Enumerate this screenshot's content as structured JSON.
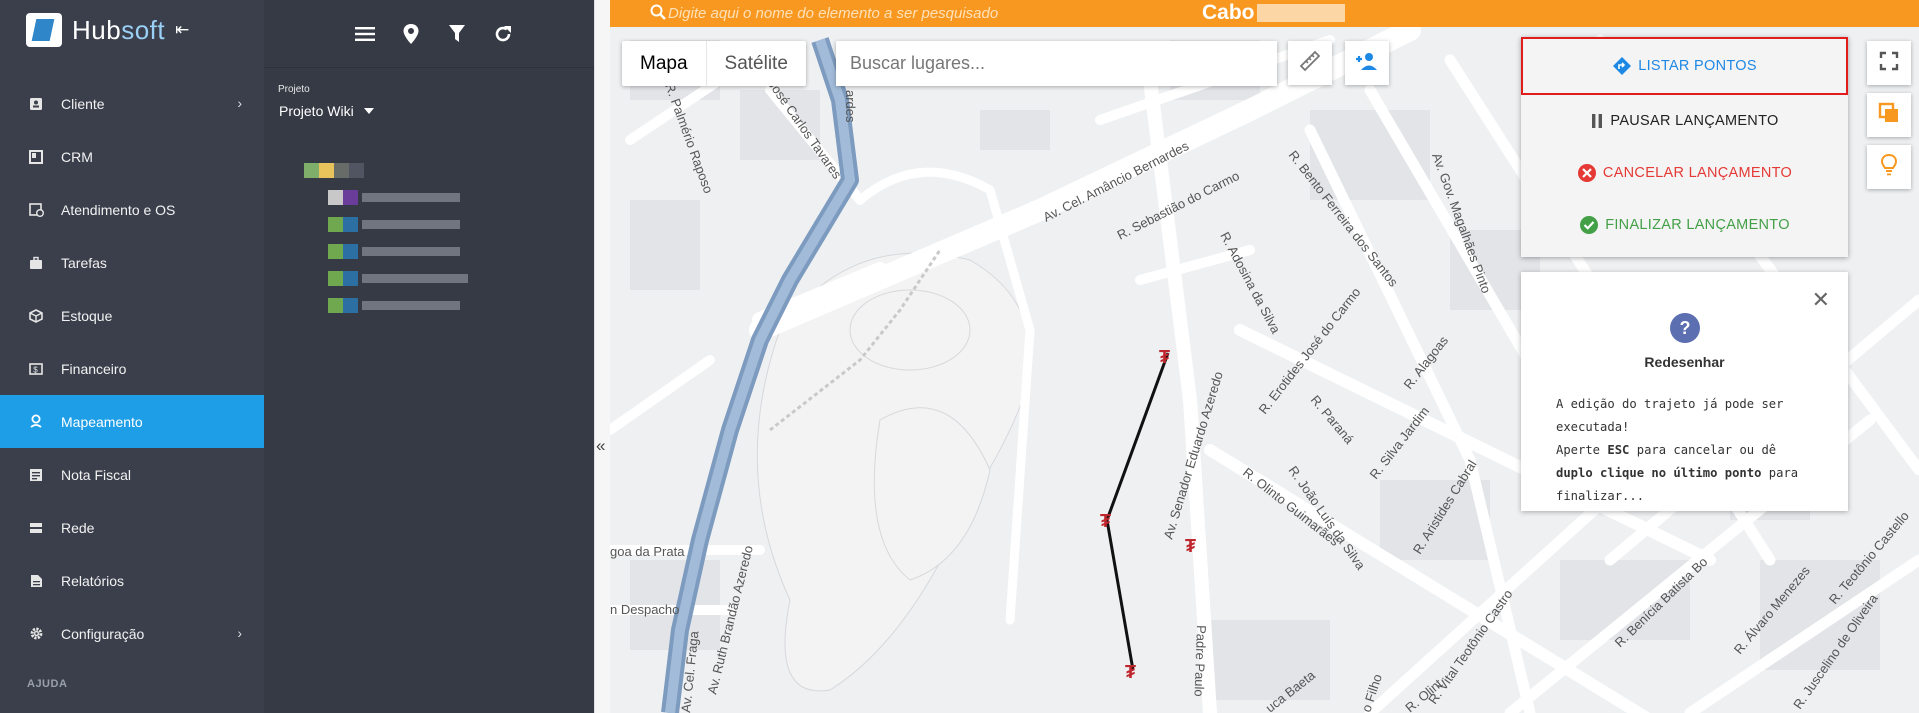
{
  "brand": {
    "name_a": "Hub",
    "name_b": "soft"
  },
  "sidebar": {
    "items": [
      {
        "label": "Cliente",
        "icon": "contact-card-icon",
        "chevron": true
      },
      {
        "label": "CRM",
        "icon": "board-icon",
        "chevron": false
      },
      {
        "label": "Atendimento e OS",
        "icon": "calendar-clock-icon",
        "chevron": false
      },
      {
        "label": "Tarefas",
        "icon": "briefcase-icon",
        "chevron": false
      },
      {
        "label": "Estoque",
        "icon": "box-icon",
        "chevron": false
      },
      {
        "label": "Financeiro",
        "icon": "money-icon",
        "chevron": false
      },
      {
        "label": "Mapeamento",
        "icon": "person-pin-icon",
        "chevron": false,
        "active": true
      },
      {
        "label": "Nota Fiscal",
        "icon": "receipt-icon",
        "chevron": false
      },
      {
        "label": "Rede",
        "icon": "server-icon",
        "chevron": false
      },
      {
        "label": "Relatórios",
        "icon": "report-icon",
        "chevron": false
      },
      {
        "label": "Configuração",
        "icon": "gear-icon",
        "chevron": true
      }
    ],
    "section": "AJUDA"
  },
  "panel": {
    "project_label": "Projeto",
    "project_value": "Projeto Wiki"
  },
  "topbar": {
    "search_placeholder": "Digite aqui o nome do elemento a ser pesquisado",
    "title": "Cabo"
  },
  "map": {
    "type_buttons": [
      "Mapa",
      "Satélite"
    ],
    "places_placeholder": "Buscar lugares...",
    "streets": [
      "R. Palmério Raposo",
      "R. José Carlos Tavares",
      "ardes",
      "Av. Cel. Amâncio Bernardes",
      "R. Sebastião do Carmo",
      "R. Bento Ferreira dos Santos",
      "Av. Gov. Magalhães Pinto",
      "R. Adosina da Silva",
      "Av. Senador Eduardo Azeredo",
      "R. Erotides José do Carmo",
      "R. Paraná",
      "R. Alagoas",
      "R. Silva Jardim",
      "R. João Luís da Silva",
      "R. Olinto Guimarães",
      "R. Aristides Cabral",
      "Av. Ruth Brandão Azeredo",
      "goa da Prata",
      "n Despacho",
      "Av. Cel. Fraga",
      "R. Vital Teotônio Castro",
      "Padre Paulo",
      "R. Benícia Batista Bo",
      "R. Álvaro Menezes",
      "R. Teotônio Castello",
      "R. Juscelino de Oliveira",
      "uca Baeta",
      "o Filho",
      "R. Olint"
    ]
  },
  "actions": {
    "list": "LISTAR PONTOS",
    "pause": "PAUSAR LANÇAMENTO",
    "cancel": "CANCELAR LANÇAMENTO",
    "finish": "FINALIZAR LANÇAMENTO"
  },
  "info": {
    "title": "Redesenhar",
    "line1": "A edição do trajeto já pode ser",
    "line2": "executada!",
    "line3_a": "Aperte ",
    "line3_b": "ESC",
    "line3_c": " para cancelar ou dê",
    "line4_a": "duplo clique no último ponto",
    "line4_b": " para",
    "line5": "finalizar..."
  },
  "colors": {
    "sidebar": "#3a3f4b",
    "panel": "#353a45",
    "active": "#1e9ee6",
    "topbar": "#f89820",
    "list": "#1e88e5",
    "cancel": "#e53935",
    "finish": "#43a047",
    "highlight": "#e21b1b"
  }
}
